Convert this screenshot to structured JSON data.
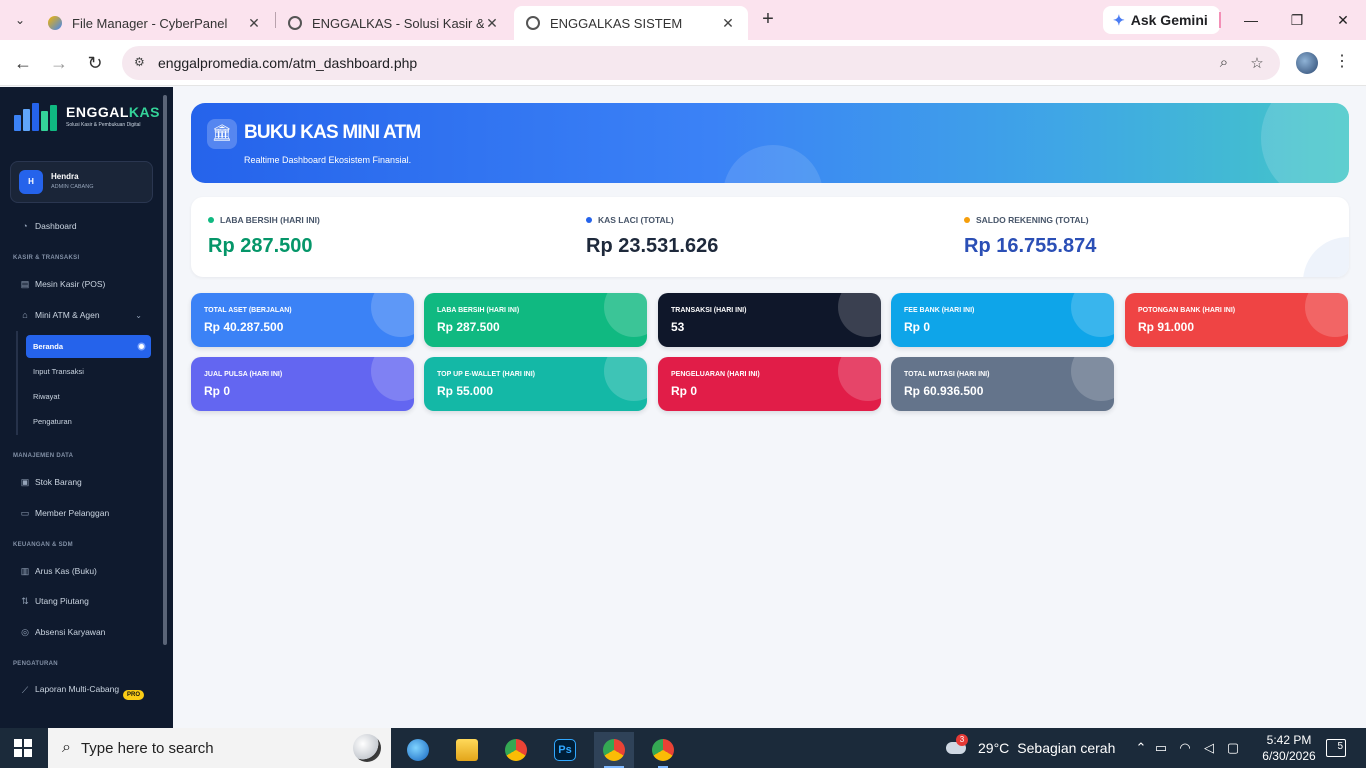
{
  "browser": {
    "tabs": [
      {
        "title": "File Manager - CyberPanel",
        "active": false
      },
      {
        "title": "ENGGALKAS - Solusi Kasir & Pe",
        "active": false
      },
      {
        "title": "ENGGALKAS SISTEM",
        "active": true
      }
    ],
    "ask_gemini": "Ask Gemini",
    "url_domain": "enggalpromedia.com",
    "url_path": "/atm_dashboard.php"
  },
  "sidebar": {
    "brand_name_a": "ENGGAL",
    "brand_name_b": "KAS",
    "tagline": "Solusi Kasir & Pembukuan Digital",
    "user": {
      "initial": "H",
      "name": "Hendra",
      "role": "ADMIN CABANG"
    },
    "dashboard": "Dashboard",
    "sections": {
      "kasir": "KASIR & TRANSAKSI",
      "manajemen": "MANAJEMEN DATA",
      "keuangan": "KEUANGAN & SDM",
      "pengaturan": "PENGATURAN"
    },
    "items": {
      "mesin_kasir": "Mesin Kasir (POS)",
      "mini_atm": "Mini ATM & Agen",
      "stok_barang": "Stok Barang",
      "member": "Member Pelanggan",
      "arus_kas": "Arus Kas (Buku)",
      "utang": "Utang Piutang",
      "absensi": "Absensi Karyawan",
      "laporan": "Laporan Multi-Cabang",
      "pro": "PRO"
    },
    "submenu": [
      "Beranda",
      "Input Transaksi",
      "Riwayat",
      "Pengaturan"
    ]
  },
  "hero": {
    "title": "BUKU KAS MINI ATM",
    "subtitle": "Realtime Dashboard Ekosistem Finansial."
  },
  "summary": [
    {
      "label": "LABA BERSIH (HARI INI)",
      "value": "Rp 287.500",
      "dot_color": "#10b981",
      "value_color": "#059669"
    },
    {
      "label": "KAS LACI (TOTAL)",
      "value": "Rp 23.531.626",
      "dot_color": "#2563eb",
      "value_color": "#1e293b"
    },
    {
      "label": "SALDO REKENING (TOTAL)",
      "value": "Rp 16.755.874",
      "dot_color": "#f59e0b",
      "value_color": "#2b4fb6"
    }
  ],
  "cards": [
    {
      "label": "TOTAL ASET (BERJALAN)",
      "value": "Rp 40.287.500",
      "color": "#3b82f6"
    },
    {
      "label": "LABA BERSIH (HARI INI)",
      "value": "Rp 287.500",
      "color": "#10b981"
    },
    {
      "label": "TRANSAKSI (HARI INI)",
      "value": "53",
      "color": "#0f172a"
    },
    {
      "label": "FEE BANK (HARI INI)",
      "value": "Rp 0",
      "color": "#0ea5e9"
    },
    {
      "label": "POTONGAN BANK (HARI INI)",
      "value": "Rp 91.000",
      "color": "#ef4444"
    },
    {
      "label": "JUAL PULSA (HARI INI)",
      "value": "Rp 0",
      "color": "#6366f1"
    },
    {
      "label": "TOP UP E-WALLET (HARI INI)",
      "value": "Rp 55.000",
      "color": "#14b8a6"
    },
    {
      "label": "PENGELUARAN (HARI INI)",
      "value": "Rp 0",
      "color": "#e11d48"
    },
    {
      "label": "TOTAL MUTASI (HARI INI)",
      "value": "Rp 60.936.500",
      "color": "#64748b"
    }
  ],
  "taskbar": {
    "search_placeholder": "Type here to search",
    "weather_temp": "29°C",
    "weather_text": "Sebagian cerah",
    "weather_badge": "3",
    "time": "5:42 PM",
    "date": "6/30/2026",
    "notif_count": "5"
  }
}
